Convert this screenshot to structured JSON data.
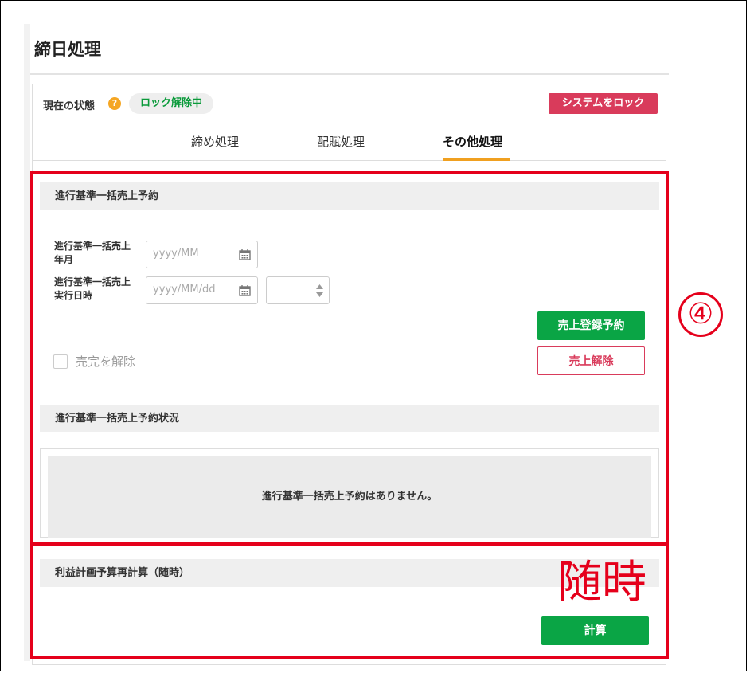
{
  "page": {
    "title": "締日処理"
  },
  "status": {
    "label": "現在の状態",
    "help_icon": "?",
    "value": "ロック解除中",
    "lock_button": "システムをロック"
  },
  "tabs": [
    {
      "label": "締め処理",
      "active": false
    },
    {
      "label": "配賦処理",
      "active": false
    },
    {
      "label": "その他処理",
      "active": true
    }
  ],
  "bulk_sales": {
    "header": "進行基準一括売上予約",
    "month_label": "進行基準一括売上年月",
    "month_placeholder": "yyyy/MM",
    "datetime_label": "進行基準一括売上実行日時",
    "date_placeholder": "yyyy/MM/dd",
    "hour_value": "",
    "register_button": "売上登録予約",
    "cancel_button": "売上解除",
    "checkbox_label": "売完を解除",
    "checkbox_checked": false
  },
  "bulk_status": {
    "header": "進行基準一括売上予約状況",
    "empty_message": "進行基準一括売上予約はありません。"
  },
  "profit_plan": {
    "header": "利益計画予算再計算（随時）",
    "calc_button": "計算"
  },
  "annotations": {
    "circle_number": "④",
    "note": "随時",
    "highlight_color": "#e5001b"
  },
  "colors": {
    "green": "#0aa545",
    "red": "#d93b5b",
    "tab_accent": "#f0a020",
    "status_green": "#0a9a3a"
  }
}
